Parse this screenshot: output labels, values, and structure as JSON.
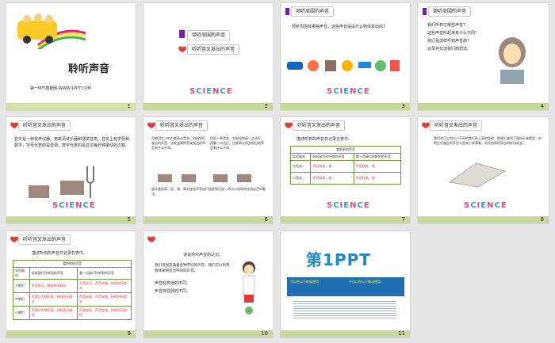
{
  "slides": [
    {
      "num": "1",
      "title": "聆听声音",
      "subtitle": "第一PPT模板网-WWW.1PPT.COM"
    },
    {
      "num": "2",
      "menu": [
        "倾听周围的声音",
        "听听音叉发出的声音"
      ]
    },
    {
      "num": "3",
      "tag": "倾听周围的声音",
      "text": "倾听周围有哪些声音，这些声音是由什么物体发出的？"
    },
    {
      "num": "4",
      "tag": "倾听周围的声音",
      "lines": [
        "我们听到过哪些声音？",
        "这些声音听起来有什么不同？",
        "我们是怎样听到声音的？",
        "记录并交流我们的想法。"
      ]
    },
    {
      "num": "5",
      "tag": "听听音叉发出的声音",
      "text": "音叉是一种发声仪器，用来调试乐器和测试音高。音叉上有字母和数字，字母代表的是音调，数字代表的是音叉每秒钟振动的次数。"
    },
    {
      "num": "6",
      "tag": "听听音叉发出的声音",
      "col1": "用相同大小的力度敲击音叉，听听它们发出的声音。比较这两种音叉发出的声音有什么不同。",
      "col2": "用同一种音叉，先轻轻地敲一点击打，再重一点击打，比较两次音叉发出的声音有什么不同。",
      "bottom": "尝试使用高、低、强、弱对这些声音进行描述和记录，再与小组同学交流自己的看法。"
    },
    {
      "num": "7",
      "tag": "听听音叉发出的声音",
      "text": "描述听到的声音并记录在表中。",
      "table_title": "我听到的声音",
      "headers": [
        "实验器材",
        "轻轻敲打时听到的声音",
        "重一点敲打时听到的声音"
      ],
      "rows": [
        [
          "大音叉",
          "声音较低，弱",
          "声音较低，强"
        ],
        [
          "小音叉",
          "声音较高，弱",
          "声音较高，强"
        ]
      ]
    },
    {
      "num": "8",
      "tag": "听听音叉发出的声音",
      "text": "我们也可以用大小不同的铁钉敲上面的实验，把铁钉放到下图所示装置里，听听它们发出的声音与音叉一样清晰，而且持续时间也同样比较长。"
    },
    {
      "num": "9",
      "tag": "听听音叉发出的声音",
      "text": "描述听到的声音并记录在表中。",
      "table_title": "我听到的声音",
      "headers": [
        "实验器材",
        "轻轻敲打时听到的声音",
        "重一点敲打时听到的声音"
      ],
      "rows": [
        [
          "大钢钉",
          "声音低沉，持续时间较长",
          "声音低沉，声音较强，持续时间较长"
        ],
        [
          "中钢钉",
          "声音比大钢钉高，持续时间较长",
          "声音较高，声音较强，持续时间较长"
        ],
        [
          "小钢钉",
          "声音比中钢钉高，持续时间较短",
          "声音较高，声音较强，持续时间较短"
        ]
      ]
    },
    {
      "num": "10",
      "lines": [
        "说说你对声音的认识。",
        "我们周围充满着各种不同的声音，我们可以利用物体来制造出不同的声音。",
        "声音有高低的不同。",
        "声音有强弱的不同。"
      ]
    },
    {
      "num": "11",
      "logo": "第1PPT",
      "left_head": "可以在以下时候使用",
      "right_head": "不可以在以下情况使用"
    }
  ],
  "science_word": "SCIENCE"
}
